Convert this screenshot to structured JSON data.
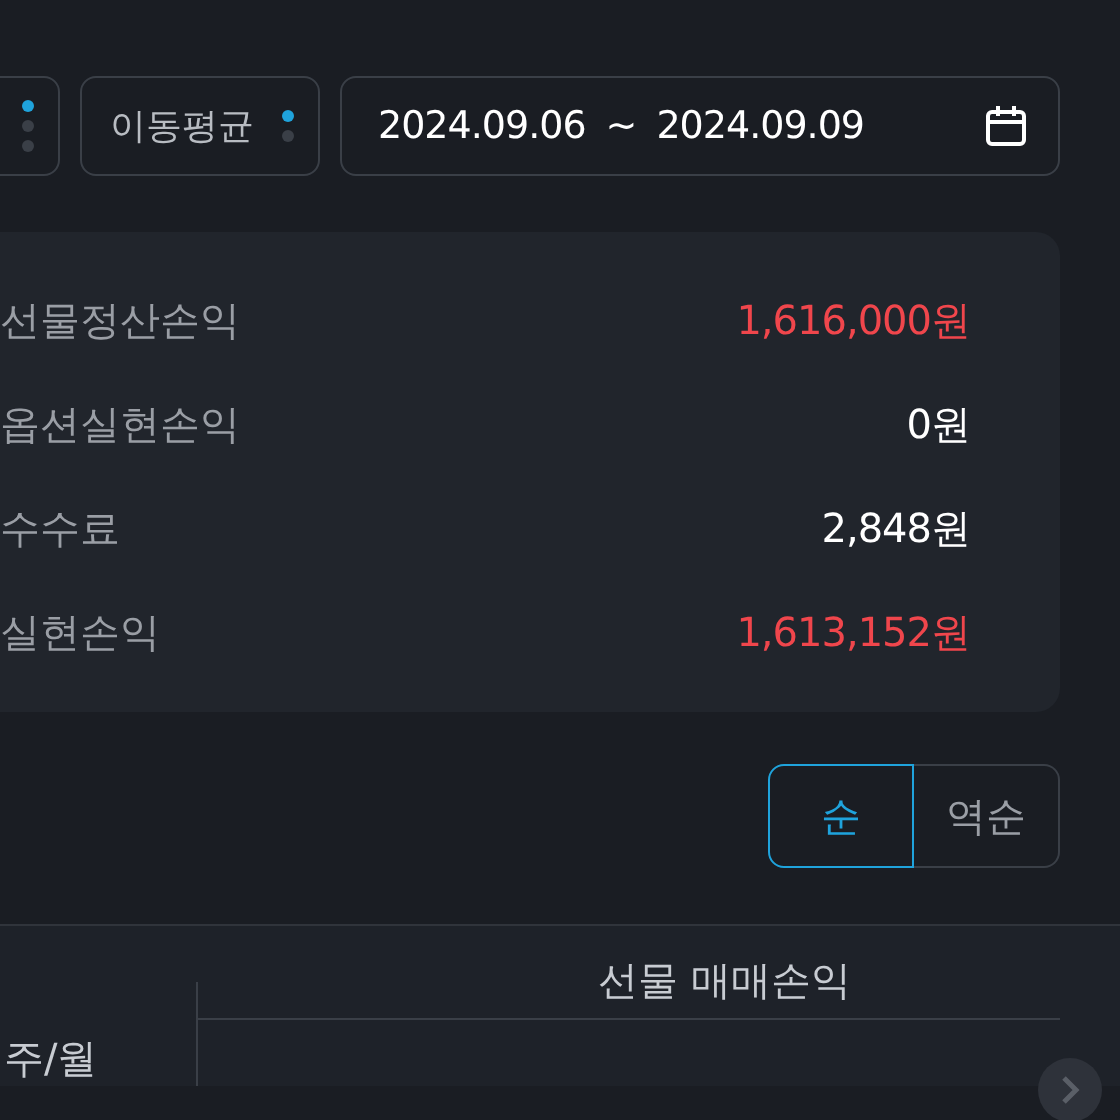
{
  "filters": [
    {
      "kind": "triple"
    },
    {
      "kind": "double",
      "label": "이동평균"
    }
  ],
  "date_range": {
    "start": "2024.09.06",
    "separator": "~",
    "end": "2024.09.09"
  },
  "summary": [
    {
      "label": "선물정산손익",
      "value": "1,616,000원",
      "color": "#f0464c"
    },
    {
      "label": "옵션실현손익",
      "value": "0원",
      "color": "#ffffff"
    },
    {
      "label": "수수료",
      "value": "2,848원",
      "color": "#ffffff"
    },
    {
      "label": "실현손익",
      "value": "1,613,152원",
      "color": "#f0464c"
    }
  ],
  "sort": [
    {
      "label": "순",
      "selected": true
    },
    {
      "label": "역순",
      "selected": false
    }
  ],
  "table": {
    "row_header": "주/월",
    "group_header": "선물 매매손익"
  }
}
